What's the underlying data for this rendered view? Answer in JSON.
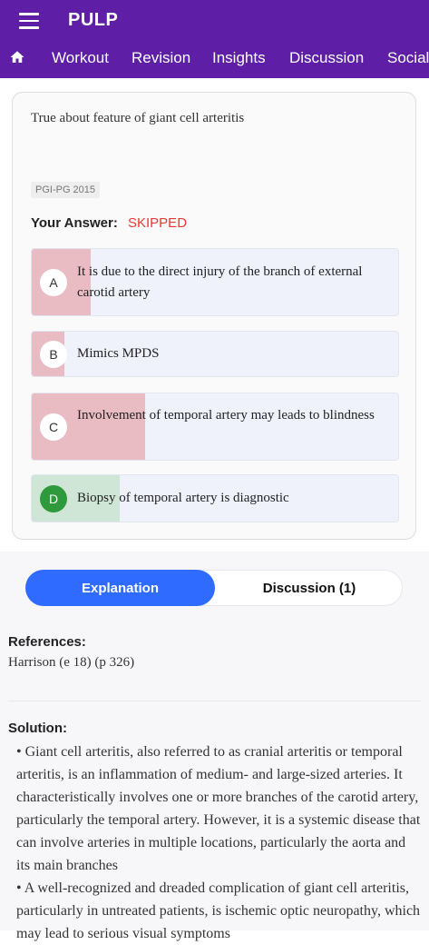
{
  "app": {
    "title": "PULP"
  },
  "nav": {
    "items": [
      "Workout",
      "Revision",
      "Insights",
      "Discussion",
      "Social"
    ]
  },
  "question": {
    "text": "True about feature of giant cell arteritis",
    "tag": "PGI-PG 2015",
    "your_answer_label": "Your Answer:",
    "your_answer_value": "SKIPPED",
    "options": [
      {
        "letter": "A",
        "text": "It is due to the direct injury of the branch of external carotid artery",
        "response_fraction": 0.16
      },
      {
        "letter": "B",
        "text": "Mimics MPDS",
        "response_fraction": 0.09
      },
      {
        "letter": "C",
        "text": "Involvement of temporal artery may leads to blindness",
        "response_fraction": 0.31
      },
      {
        "letter": "D",
        "text": "Biopsy of temporal artery is diagnostic",
        "response_fraction": 0.24,
        "correct": true
      }
    ]
  },
  "tabs": {
    "explanation": "Explanation",
    "discussion": "Discussion (1)"
  },
  "references": {
    "heading": "References:",
    "text": "Harrison (e 18) (p 326)"
  },
  "solution": {
    "heading": "Solution:",
    "points": [
      "•  Giant cell arteritis, also referred to as cranial arteritis or temporal arteritis, is an inflammation of medium- and large-sized arteries. It characteristically involves one or more branches of the carotid artery, particularly the temporal artery. However, it is a systemic disease that can involve arteries in multiple locations, particularly the aorta and its main branches",
      "•  A well-recognized and dreaded complication of giant cell arteritis, particularly in untreated patients, is ischemic optic neuropathy, which may lead to serious visual symptoms"
    ]
  },
  "colors": {
    "brand": "#5e1fa6",
    "accent": "#2f6bff",
    "wrong_fill": "#e9bcc4",
    "correct_fill": "#cfe6d6",
    "skipped": "#e53935"
  }
}
